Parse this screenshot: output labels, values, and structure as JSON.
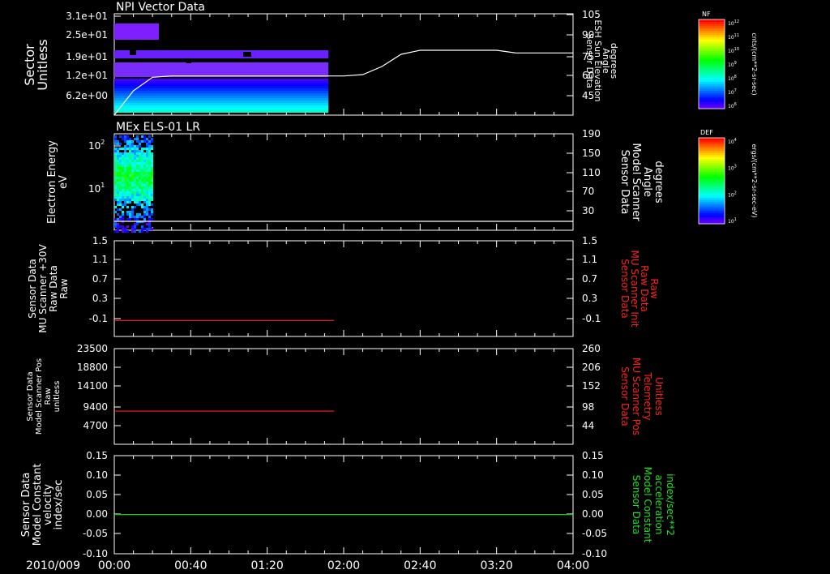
{
  "date_label": "2010/009",
  "time_ticks": [
    "00:00",
    "00:40",
    "01:20",
    "02:00",
    "02:40",
    "03:20",
    "04:00"
  ],
  "panels": [
    {
      "title": "NPI Vector Data",
      "left_label": [
        "Sector",
        "Unitless"
      ],
      "left_ticks": [
        "3.1e+01",
        "2.5e+01",
        "1.9e+01",
        "1.2e+01",
        "6.2e+00"
      ],
      "right_label": [
        "Sensor Data",
        "ESH Sun Elevation",
        "Angle",
        "degrees"
      ],
      "right_ticks": [
        "105",
        "90",
        "75",
        "60",
        "45"
      ]
    },
    {
      "title": "MEx ELS-01 LR",
      "left_label": [
        "Electron Energy",
        "eV"
      ],
      "left_ticks": [
        "10",
        "10",
        "10"
      ],
      "left_tick_exponents": [
        "2",
        "1",
        ""
      ],
      "right_label": [
        "Sensor Data",
        "Model Scanner",
        "Angle",
        "degrees"
      ],
      "right_ticks": [
        "190",
        "150",
        "110",
        "70",
        "30"
      ]
    },
    {
      "title": "",
      "left_label": [
        "Sensor Data",
        "MU Scanner +30V",
        "Raw Data",
        "Raw"
      ],
      "left_ticks": [
        "1.5",
        "1.1",
        "0.7",
        "0.3",
        "-0.1"
      ],
      "right_label": [
        "Sensor Data",
        "MU Scanner Init",
        "Raw Data",
        "Raw"
      ],
      "right_ticks": [
        "1.5",
        "1.1",
        "0.7",
        "0.3",
        "-0.1"
      ]
    },
    {
      "title": "",
      "left_label": [
        "Sensor Data",
        "Model Scanner Pos",
        "Raw",
        "unitless"
      ],
      "left_ticks": [
        "23500",
        "18800",
        "14100",
        "9400",
        "4700"
      ],
      "right_label": [
        "Sensor Data",
        "MU Scanner Pos",
        "Telemetry",
        "Unitless"
      ],
      "right_ticks": [
        "260",
        "206",
        "152",
        "98",
        "44"
      ]
    },
    {
      "title": "",
      "left_label": [
        "Sensor Data",
        "Model Constant",
        "velocity",
        "index/sec"
      ],
      "left_ticks": [
        "0.15",
        "0.10",
        "0.05",
        "0.00",
        "-0.05",
        "-0.10"
      ],
      "right_label": [
        "Sensor Data",
        "Model Constant",
        "acceleration",
        "index/sec**2"
      ],
      "right_ticks": [
        "0.15",
        "0.10",
        "0.05",
        "0.00",
        "-0.05",
        "-0.10"
      ]
    }
  ],
  "colorbars": [
    {
      "title": "NF",
      "ticks": [
        "10",
        "10",
        "10",
        "10",
        "10",
        "10"
      ],
      "tick_exponents": [
        "12",
        "11",
        "10",
        "9",
        "8",
        "7",
        "6"
      ],
      "unit": "cnts/(cm**2-sr-sec)"
    },
    {
      "title": "DEF",
      "ticks": [
        "10",
        "10",
        "10"
      ],
      "tick_exponents": [
        "4",
        "3",
        "2",
        "1"
      ],
      "unit": "ergs/(cm**2-sr-sec-eV)"
    }
  ],
  "colors": {
    "background": "#000000",
    "axes": "#ffffff",
    "series_red": "#ff2020",
    "series_green": "#20d020",
    "label_red": "#ff2020",
    "label_green": "#20e020",
    "spectro_purple": "#6a1fff"
  },
  "chart_data": [
    {
      "type": "heatmap",
      "panel": 1,
      "x_range_hours": [
        0,
        4
      ],
      "x": [
        "00:00",
        "00:10",
        "00:20",
        "00:30",
        "00:40",
        "00:50",
        "01:00",
        "01:10",
        "01:20",
        "01:30",
        "01:40",
        "01:50"
      ],
      "ylim_left": [
        0,
        32
      ],
      "ylim_right": [
        30,
        105
      ],
      "data_end_time": "01:52",
      "line_series": {
        "axis": "right",
        "x": [
          "00:00",
          "00:10",
          "00:20",
          "00:30",
          "01:00",
          "01:30",
          "02:00",
          "02:10",
          "02:20",
          "02:30",
          "02:40",
          "03:00",
          "03:20",
          "03:30",
          "03:40",
          "04:00"
        ],
        "values": [
          30,
          48,
          58,
          59,
          59,
          59,
          59,
          60,
          66,
          75,
          78,
          78,
          78,
          76,
          76,
          76
        ]
      }
    },
    {
      "type": "heatmap",
      "panel": 2,
      "x_range_hours": [
        0,
        4
      ],
      "data_time_range": [
        "00:00",
        "00:20"
      ],
      "ylim_left_log": [
        1,
        200
      ],
      "ylim_right": [
        10,
        190
      ],
      "line_series": {
        "axis": "right",
        "x": [
          "00:00",
          "04:00"
        ],
        "values": [
          10,
          10
        ]
      }
    },
    {
      "type": "line",
      "panel": 3,
      "ylim": [
        -0.3,
        1.5
      ],
      "x": [
        "00:00",
        "01:55"
      ],
      "series": [
        {
          "values": [
            0.0,
            0.0
          ]
        }
      ]
    },
    {
      "type": "line",
      "panel": 4,
      "ylim": [
        0,
        23500
      ],
      "x": [
        "00:00",
        "01:55"
      ],
      "series": [
        {
          "values": [
            8150,
            8150
          ]
        }
      ]
    },
    {
      "type": "line",
      "panel": 5,
      "ylim": [
        -0.1,
        0.15
      ],
      "x": [
        "00:00",
        "04:00"
      ],
      "series": [
        {
          "values": [
            0.0,
            0.0
          ]
        }
      ]
    }
  ]
}
